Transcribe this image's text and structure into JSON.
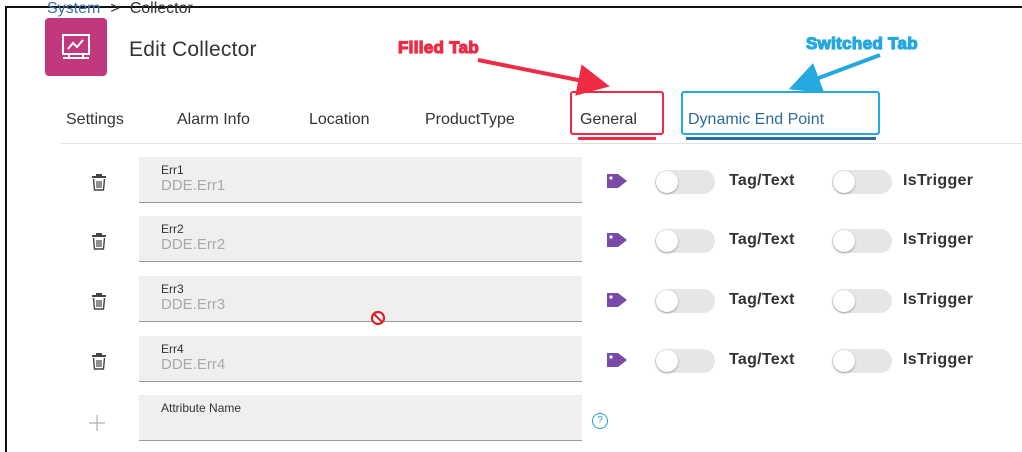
{
  "breadcrumb": {
    "parent": "System",
    "separator": ">",
    "current": "Collector"
  },
  "header": {
    "title": "Edit Collector",
    "icon": "collector-icon"
  },
  "tabs": [
    {
      "label": "Settings"
    },
    {
      "label": "Alarm Info"
    },
    {
      "label": "Location"
    },
    {
      "label": "ProductType"
    },
    {
      "label": "General"
    },
    {
      "label": "Dynamic End Point"
    }
  ],
  "annotations": {
    "filled_tab": "Filled Tab",
    "switched_tab": "Switched Tab"
  },
  "rows": [
    {
      "label": "Err1",
      "value": "DDE.Err1",
      "toggle1_label": "Tag/Text",
      "toggle2_label": "IsTrigger"
    },
    {
      "label": "Err2",
      "value": "DDE.Err2",
      "toggle1_label": "Tag/Text",
      "toggle2_label": "IsTrigger"
    },
    {
      "label": "Err3",
      "value": "DDE.Err3",
      "toggle1_label": "Tag/Text",
      "toggle2_label": "IsTrigger"
    },
    {
      "label": "Err4",
      "value": "DDE.Err4",
      "toggle1_label": "Tag/Text",
      "toggle2_label": "IsTrigger"
    }
  ],
  "new_row": {
    "placeholder_label": "Attribute Name",
    "help": "?"
  },
  "colors": {
    "brand": "#c2387d",
    "tag": "#7a4aa8",
    "active_tab": "#2c6aa0",
    "annotation_red": "#ee2a45",
    "annotation_blue": "#25a7e0"
  }
}
